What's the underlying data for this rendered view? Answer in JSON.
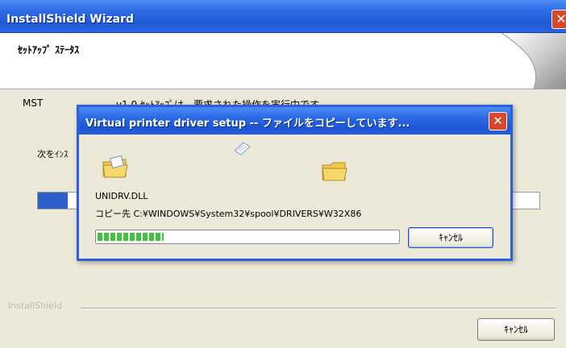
{
  "main_window": {
    "title": "InstallShield Wizard",
    "close_glyph": "✕",
    "subtitle": "ｾｯﾄｱｯﾌﾟ ｽﾃｰﾀｽ",
    "status_left": "MST",
    "status_right": "v1.0 ｾｯﾄｱｯﾌﾟは、要求された操作を実行中です。",
    "status_tag": "次をｲﾝｽ",
    "background_progress": 0.06,
    "brand": "InstallShield",
    "cancel_label": "ｷｬﾝｾﾙ"
  },
  "copy_dialog": {
    "title": "Virtual printer driver setup -- ファイルをコピーしています...",
    "close_glyph": "✕",
    "file_name": "UNIDRV.DLL",
    "destination": "コピー先 C:¥WINDOWS¥System32¥spool¥DRIVERS¥W32X86",
    "progress": 0.22,
    "cancel_label": "ｷｬﾝｾﾙ"
  },
  "colors": {
    "title_bar": "#2a64e2",
    "progress_green": "#3cc43c",
    "close_red": "#d9482b",
    "face": "#ece9d8"
  }
}
